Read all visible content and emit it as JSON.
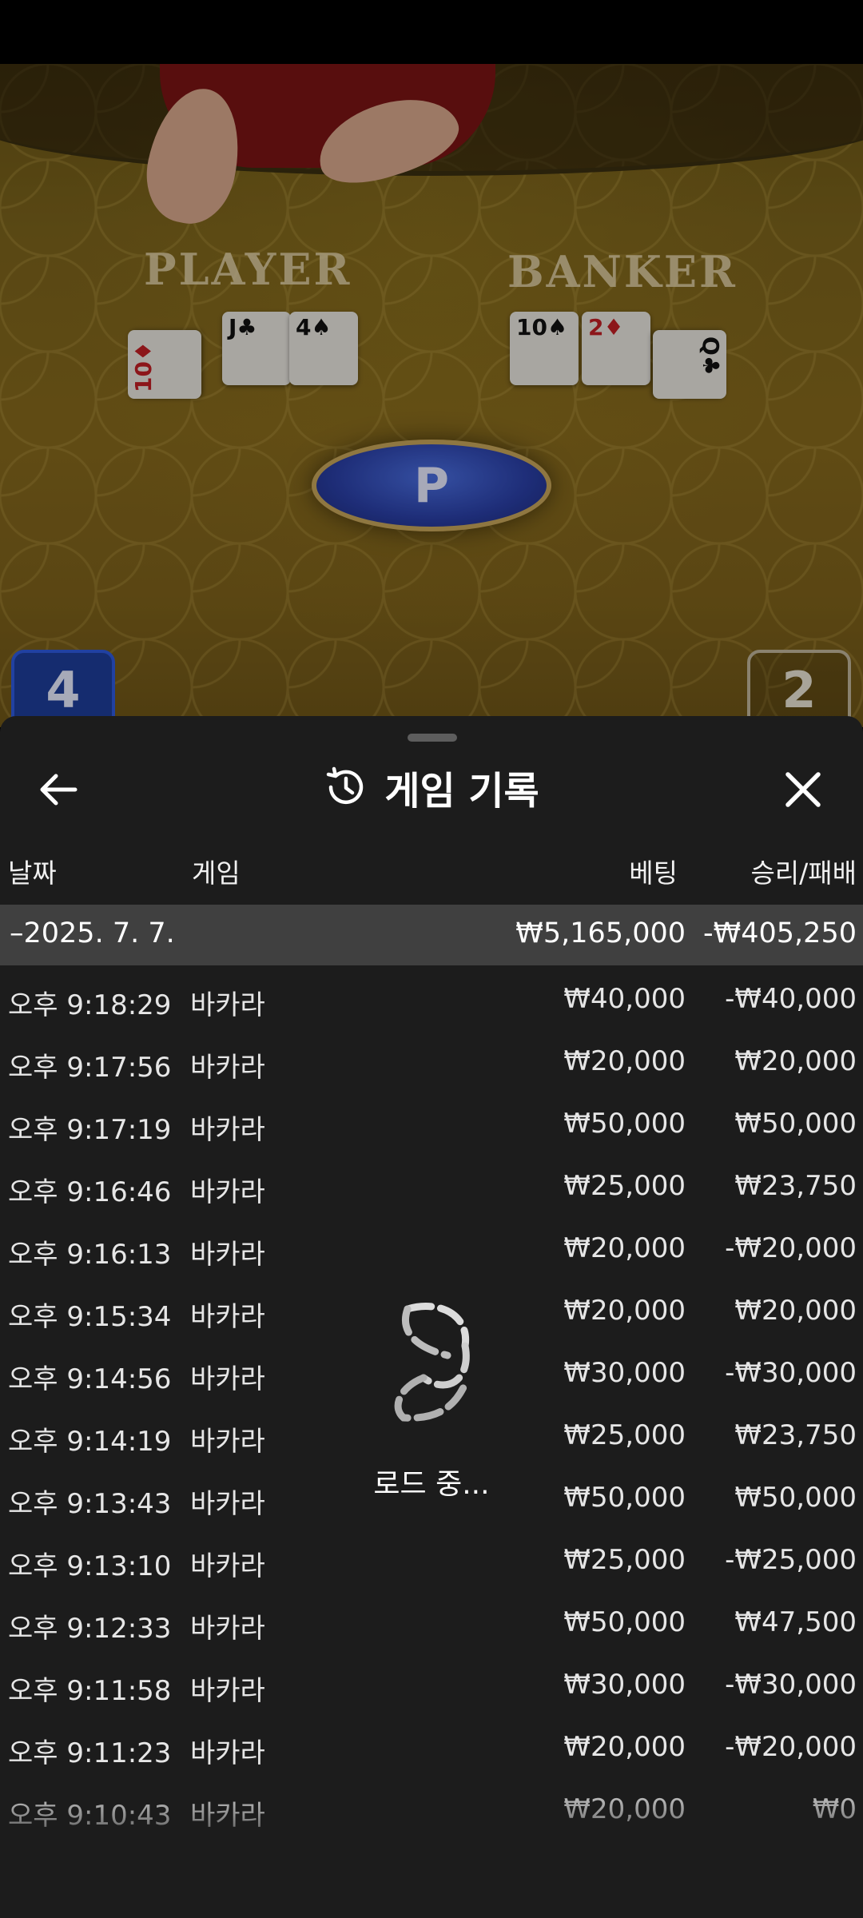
{
  "game_view": {
    "player_label": "PLAYER",
    "banker_label": "BANKER",
    "player_cards": [
      {
        "rank": "10",
        "suit": "♦",
        "color": "red"
      },
      {
        "rank": "J",
        "suit": "♣",
        "color": "black"
      },
      {
        "rank": "4",
        "suit": "♠",
        "color": "black"
      }
    ],
    "banker_cards": [
      {
        "rank": "10",
        "suit": "♠",
        "color": "black"
      },
      {
        "rank": "2",
        "suit": "♦",
        "color": "red"
      },
      {
        "rank": "Q",
        "suit": "♣",
        "color": "black"
      }
    ],
    "result_letter": "P",
    "player_score": "4",
    "banker_score": "2"
  },
  "sheet": {
    "title": "게임 기록",
    "back_icon": "arrow-left-icon",
    "history_icon": "history-icon",
    "close_icon": "close-icon",
    "columns": {
      "date": "날짜",
      "game": "게임",
      "bet": "베팅",
      "win_loss": "승리/패배"
    },
    "date_group": {
      "date": "–2025. 7. 7.",
      "bet_total": "₩5,165,000",
      "win_loss_total": "-₩405,250"
    },
    "rows": [
      {
        "time": "오후 9:18:29",
        "game": "바카라",
        "bet": "₩40,000",
        "win_loss": "-₩40,000"
      },
      {
        "time": "오후 9:17:56",
        "game": "바카라",
        "bet": "₩20,000",
        "win_loss": "₩20,000"
      },
      {
        "time": "오후 9:17:19",
        "game": "바카라",
        "bet": "₩50,000",
        "win_loss": "₩50,000"
      },
      {
        "time": "오후 9:16:46",
        "game": "바카라",
        "bet": "₩25,000",
        "win_loss": "₩23,750"
      },
      {
        "time": "오후 9:16:13",
        "game": "바카라",
        "bet": "₩20,000",
        "win_loss": "-₩20,000"
      },
      {
        "time": "오후 9:15:34",
        "game": "바카라",
        "bet": "₩20,000",
        "win_loss": "₩20,000"
      },
      {
        "time": "오후 9:14:56",
        "game": "바카라",
        "bet": "₩30,000",
        "win_loss": "-₩30,000"
      },
      {
        "time": "오후 9:14:19",
        "game": "바카라",
        "bet": "₩25,000",
        "win_loss": "₩23,750"
      },
      {
        "time": "오후 9:13:43",
        "game": "바카라",
        "bet": "₩50,000",
        "win_loss": "₩50,000"
      },
      {
        "time": "오후 9:13:10",
        "game": "바카라",
        "bet": "₩25,000",
        "win_loss": "-₩25,000"
      },
      {
        "time": "오후 9:12:33",
        "game": "바카라",
        "bet": "₩50,000",
        "win_loss": "₩47,500"
      },
      {
        "time": "오후 9:11:58",
        "game": "바카라",
        "bet": "₩30,000",
        "win_loss": "-₩30,000"
      },
      {
        "time": "오후 9:11:23",
        "game": "바카라",
        "bet": "₩20,000",
        "win_loss": "-₩20,000"
      },
      {
        "time": "오후 9:10:43",
        "game": "바카라",
        "bet": "₩20,000",
        "win_loss": "₩0"
      }
    ],
    "loading_text": "로드 중...",
    "loading_icon": "loading-spinner-icon"
  }
}
